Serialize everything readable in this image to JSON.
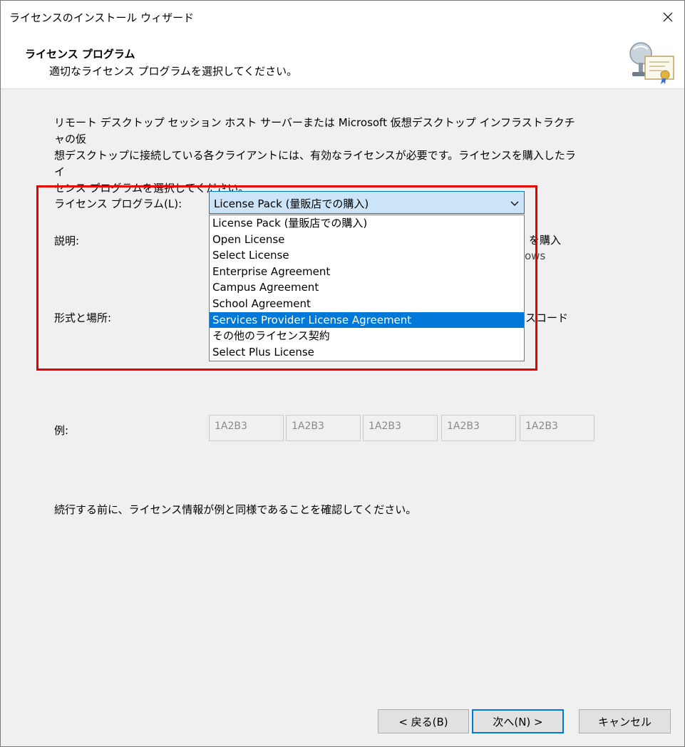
{
  "window": {
    "title": "ライセンスのインストール ウィザード",
    "close_icon": "close-icon"
  },
  "header": {
    "title": "ライセンス プログラム",
    "subtitle": "適切なライセンス プログラムを選択してください。",
    "icon": "certificate-icon"
  },
  "main": {
    "description": "リモート デスクトップ セッション ホスト サーバーまたは Microsoft 仮想デスクトップ インフラストラクチャの仮\n想デスクトップに接続している各クライアントには、有効なライセンスが必要です。ライセンスを購入したライ\nセンス プログラムを選択してください。",
    "license_program_label": "ライセンス プログラム(L):",
    "explanation_label": "説明:",
    "format_location_label": "形式と場所:",
    "explanation_clipped_1": "を購入",
    "explanation_clipped_2": "ows",
    "format_clipped": "スコード",
    "example_label": "例:",
    "example_codes": [
      "1A2B3",
      "1A2B3",
      "1A2B3",
      "1A2B3",
      "1A2B3"
    ],
    "confirm_note": "続行する前に、ライセンス情報が例と同様であることを確認してください。"
  },
  "license_combo": {
    "selected_value": "License Pack (量販店での購入)",
    "chevron_icon": "chevron-down-icon",
    "options": [
      "License Pack (量販店での購入)",
      "Open License",
      "Select License",
      "Enterprise Agreement",
      "Campus Agreement",
      "School Agreement",
      "Services Provider License Agreement",
      "その他のライセンス契約",
      "Select Plus License"
    ],
    "highlighted_option": "Services Provider License Agreement"
  },
  "buttons": {
    "back": "< 戻る(B)",
    "next": "次へ(N) >",
    "cancel": "キャンセル"
  },
  "colors": {
    "highlight": "#0078d7",
    "annotation_frame": "#e60000",
    "dialog_background": "#f0f0f0"
  }
}
